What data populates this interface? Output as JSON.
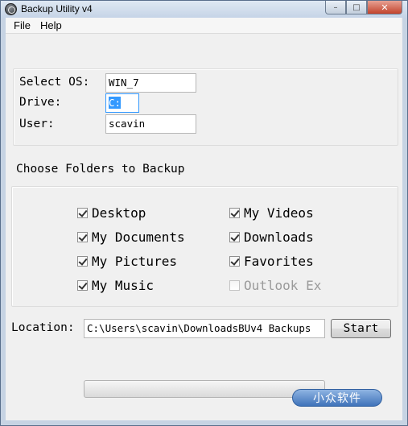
{
  "window": {
    "title": "Backup Utility v4",
    "controls": {
      "minimize": "–",
      "maximize": "□",
      "close": "✕"
    }
  },
  "menu": {
    "items": [
      "File",
      "Help"
    ]
  },
  "system": {
    "select_os_label": "Select OS:",
    "select_os_value": "WIN_7",
    "drive_label": "Drive:",
    "drive_value": "C:",
    "user_label": "User:",
    "user_value": "scavin"
  },
  "folders": {
    "heading": "Choose Folders to Backup",
    "items": [
      {
        "label": "Desktop",
        "checked": true,
        "enabled": true
      },
      {
        "label": "My Documents",
        "checked": true,
        "enabled": true
      },
      {
        "label": "My Pictures",
        "checked": true,
        "enabled": true
      },
      {
        "label": "My Music",
        "checked": true,
        "enabled": true
      },
      {
        "label": "My Videos",
        "checked": true,
        "enabled": true
      },
      {
        "label": "Downloads",
        "checked": true,
        "enabled": true
      },
      {
        "label": "Favorites",
        "checked": true,
        "enabled": true
      },
      {
        "label": "Outlook Ex",
        "checked": false,
        "enabled": false
      }
    ]
  },
  "location": {
    "label": "Location:",
    "value": "C:\\Users\\scavin\\DownloadsBUv4 Backups",
    "start_label": "Start"
  },
  "progress": {
    "value": 0
  },
  "watermark": {
    "text": "小众软件",
    "color": "#3f73ba"
  },
  "colors": {
    "title_bar": "#c4d3e6",
    "close_button": "#c2432c",
    "selection": "#3399ff"
  }
}
